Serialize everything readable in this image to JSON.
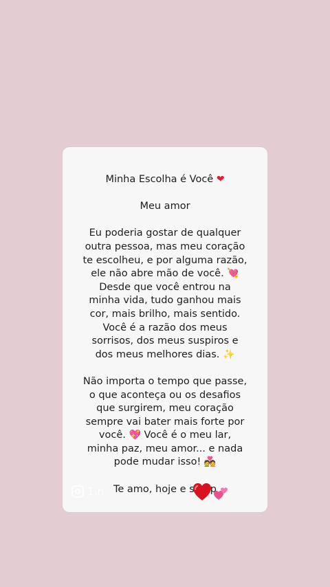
{
  "post": {
    "title": "Minha Escolha é Você",
    "salutation": "Meu amor",
    "paragraph1": [
      "Eu poderia gostar de qualquer",
      "outra pessoa, mas meu coração",
      "te escolheu, e por alguma razão,",
      "ele não abre mão de você.",
      "Desde que você entrou na",
      "minha vida, tudo ganhou mais",
      "cor, mais brilho, mais sentido.",
      "Você é a razão dos meus",
      "sorrisos, dos meus suspiros e",
      "dos meus melhores dias."
    ],
    "paragraph2": [
      "Não importa o tempo que passe,",
      "o que aconteça ou os desafios",
      "que surgirem, meu coração",
      "sempre vai bater mais forte por",
      "você.",
      "Você é o meu lar,",
      "minha paz, meu amor... e nada",
      "pode mudar isso!"
    ],
    "closing": "Te amo, hoje e semp"
  },
  "watermark": {
    "text": "1.n"
  },
  "icons": {
    "title_heart": "red-heart-icon",
    "arrow_heart": "heart-with-arrow-icon",
    "sparkles": "sparkles-icon",
    "sparkling_heart": "sparkling-heart-icon",
    "couple": "couple-with-heart-icon",
    "big_heart": "large-red-heart-sticker-icon",
    "two_hearts": "two-hearts-icon",
    "camera": "camera-icon"
  },
  "colors": {
    "background": "#e4ccd3",
    "card": "#f8f7f8",
    "text": "#1d1d1d",
    "heart_red": "#e0202f",
    "heart_pink": "#e0568a"
  }
}
